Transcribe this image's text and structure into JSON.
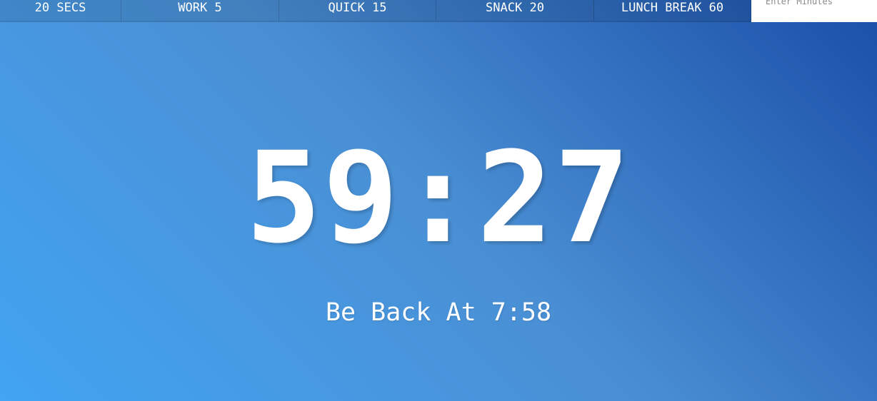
{
  "timer_buttons": [
    {
      "label": "20 Secs"
    },
    {
      "label": "Work 5"
    },
    {
      "label": "Quick 15"
    },
    {
      "label": "Snack 20"
    },
    {
      "label": "Lunch Break 60"
    }
  ],
  "custom_input": {
    "placeholder": "Enter Minutes",
    "value": ""
  },
  "display": {
    "time_left": "59:27",
    "end_time": "Be Back At 7:58"
  },
  "colors": {
    "gradient_start": "#42a4f2",
    "gradient_end": "#1a4fa8",
    "text": "#ffffff"
  }
}
